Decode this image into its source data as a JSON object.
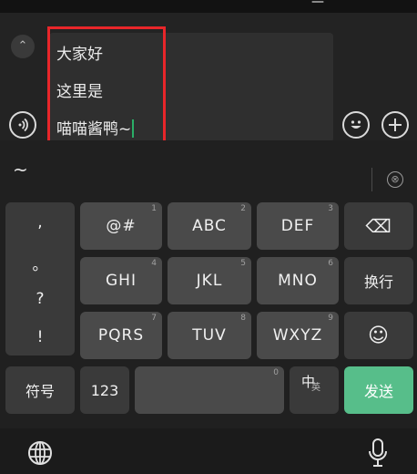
{
  "status_bar": {
    "glyph": "—"
  },
  "compose": {
    "collapse_icon": "⌃",
    "lines": [
      "大家好",
      "这里是",
      "喵喵酱鸭~"
    ],
    "voice_icon": "voice-icon",
    "emoji_icon": "emoji-icon",
    "plus_icon": "plus-icon"
  },
  "candidates": {
    "text": "~",
    "close_icon": "⊗"
  },
  "keyboard": {
    "punctuation": [
      ",",
      "。",
      "?",
      "!"
    ],
    "rows": [
      [
        {
          "label": "@#",
          "num": "1"
        },
        {
          "label": "ABC",
          "num": "2"
        },
        {
          "label": "DEF",
          "num": "3"
        }
      ],
      [
        {
          "label": "GHI",
          "num": "4"
        },
        {
          "label": "JKL",
          "num": "5"
        },
        {
          "label": "MNO",
          "num": "6"
        }
      ],
      [
        {
          "label": "PQRS",
          "num": "7"
        },
        {
          "label": "TUV",
          "num": "8"
        },
        {
          "label": "WXYZ",
          "num": "9"
        }
      ]
    ],
    "backspace_icon": "⌫",
    "newline_label": "换行",
    "emoji_key_icon": "☺",
    "symbols_label": "符号",
    "numbers_label": "123",
    "space_num": "0",
    "lang_zh": "中",
    "lang_en": "英",
    "send_label": "发送"
  },
  "bottom": {
    "globe_icon": "globe-icon",
    "mic_icon": "microphone-icon"
  },
  "colors": {
    "send": "#57be8a",
    "caret": "#2aae67",
    "highlight": "#e8262a"
  }
}
